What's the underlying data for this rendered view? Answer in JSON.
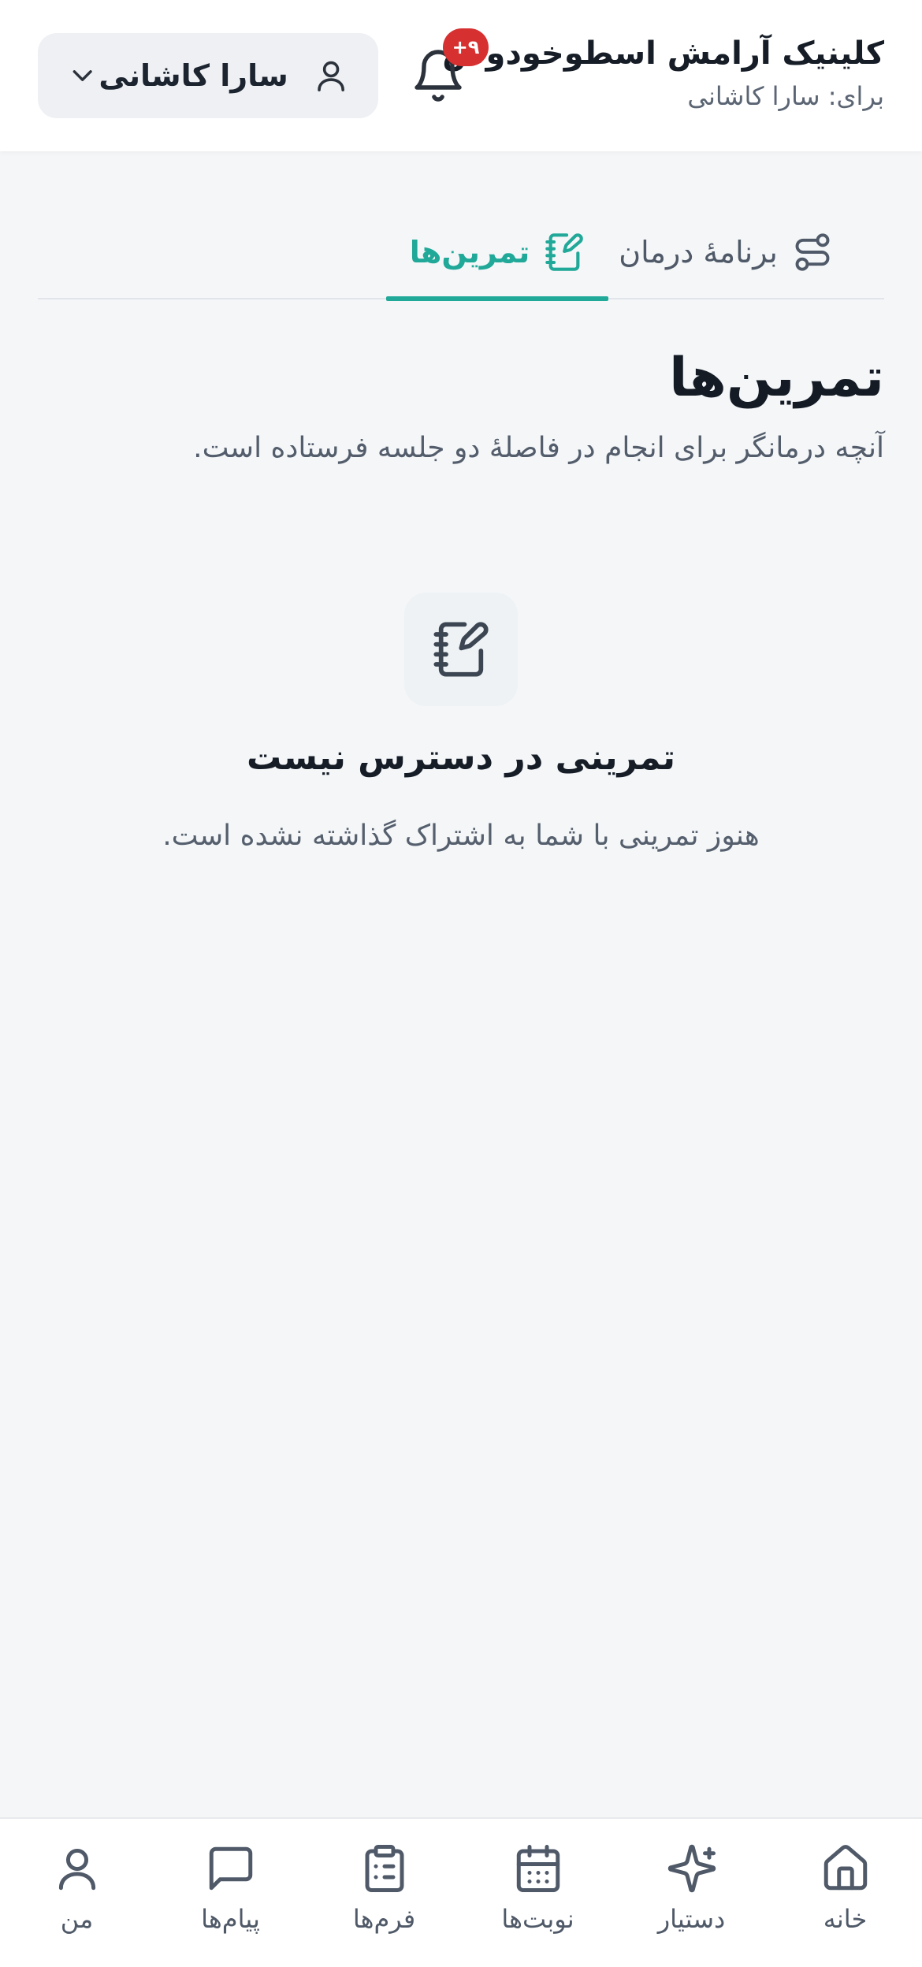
{
  "header": {
    "clinic_name": "کلینیک آرامش اسطوخودوس",
    "for_label": "برای: سارا کاشانی",
    "notification_badge": "۹+",
    "profile_name": "سارا کاشانی"
  },
  "tabs": [
    {
      "label": "برنامهٔ درمان",
      "icon": "route-icon",
      "active": false
    },
    {
      "label": "تمرین‌ها",
      "icon": "notebook-pen-icon",
      "active": true
    }
  ],
  "page": {
    "title": "تمرین‌ها",
    "subtitle": "آنچه درمانگر برای انجام در فاصلهٔ دو جلسه فرستاده است."
  },
  "empty_state": {
    "icon": "notebook-pen-icon",
    "title": "تمرینی در دسترس نیست",
    "description": "هنوز تمرینی با شما به اشتراک گذاشته نشده است."
  },
  "bottom_nav": [
    {
      "label": "خانه",
      "icon": "home-icon"
    },
    {
      "label": "دستیار",
      "icon": "sparkles-icon"
    },
    {
      "label": "نوبت‌ها",
      "icon": "calendar-icon"
    },
    {
      "label": "فرم‌ها",
      "icon": "clipboard-icon"
    },
    {
      "label": "پیام‌ها",
      "icon": "message-icon"
    },
    {
      "label": "من",
      "icon": "user-icon"
    }
  ],
  "colors": {
    "accent": "#20a898",
    "badge": "#d63031",
    "background": "#f4f6f8"
  }
}
